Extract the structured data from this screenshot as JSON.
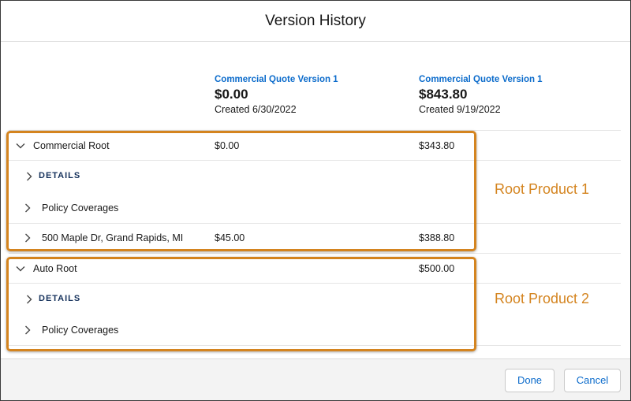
{
  "dialog": {
    "title": "Version History"
  },
  "versions": [
    {
      "name": "Commercial Quote Version 1",
      "total": "$0.00",
      "created": "Created 6/30/2022"
    },
    {
      "name": "Commercial Quote Version 1",
      "total": "$843.80",
      "created": "Created 9/19/2022"
    }
  ],
  "rows": {
    "commercial_root": {
      "label": "Commercial Root",
      "v1": "$0.00",
      "v2": "$343.80"
    },
    "commercial_details": {
      "label": "DETAILS"
    },
    "commercial_coverages": {
      "label": "Policy Coverages"
    },
    "maple": {
      "label": "500 Maple Dr, Grand Rapids, MI",
      "v1": "$45.00",
      "v2": "$388.80"
    },
    "auto_root": {
      "label": "Auto Root",
      "v1": "",
      "v2": "$500.00"
    },
    "auto_details": {
      "label": "DETAILS"
    },
    "auto_coverages": {
      "label": "Policy Coverages"
    }
  },
  "annotations": {
    "root1": "Root Product 1",
    "root2": "Root Product 2"
  },
  "footer": {
    "done_label": "Done",
    "cancel_label": "Cancel"
  },
  "colors": {
    "link": "#0b6bcb",
    "highlight": "#d4841f",
    "details_text": "#16325c"
  },
  "icons": {
    "expanded": "chevron-down-icon",
    "collapsed": "chevron-right-icon"
  }
}
